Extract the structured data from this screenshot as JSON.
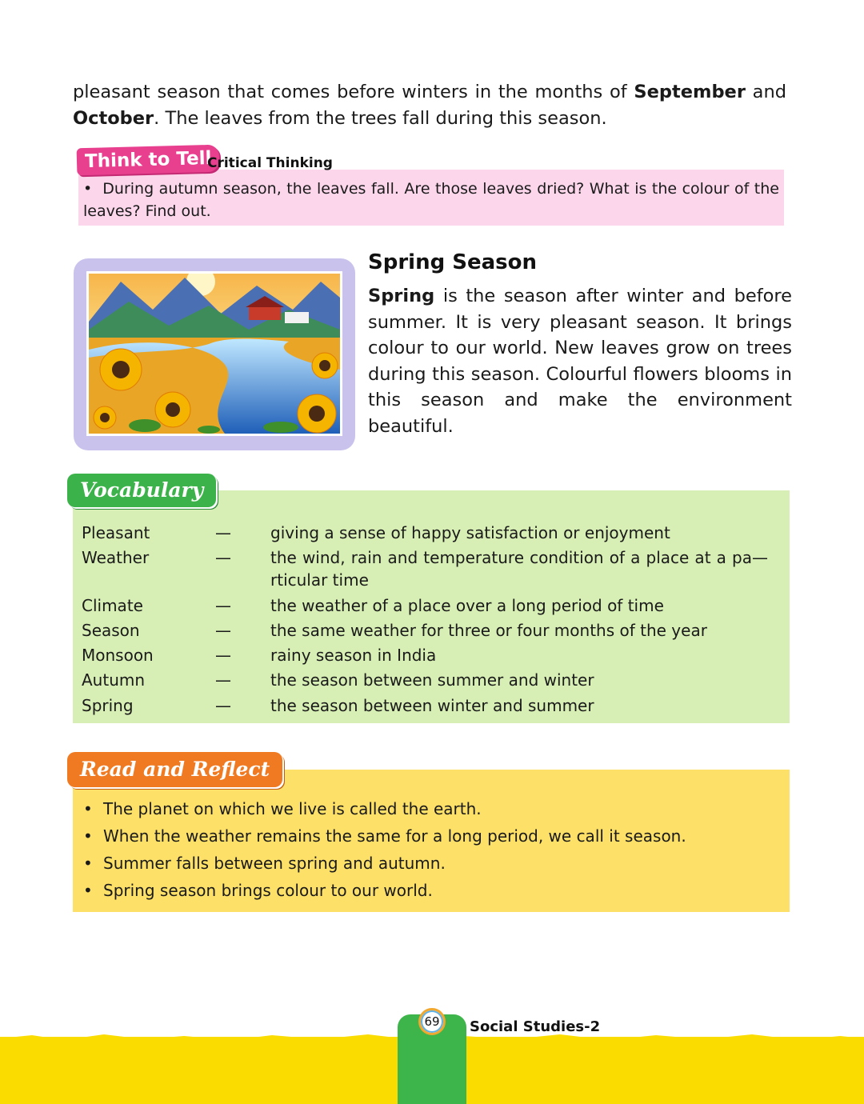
{
  "intro": {
    "part1": "pleasant season that comes before winters in the months of ",
    "bold1": "September",
    "part2": " and ",
    "bold2": "October",
    "part3": ". The leaves from the trees fall during this season."
  },
  "think_to_tell": {
    "tag": "Think to Tell",
    "subtitle": "Critical Thinking",
    "bullet": "•",
    "text": "During autumn season, the leaves fall. Are those leaves dried? What is the colour of the leaves? Find out."
  },
  "spring": {
    "title": "Spring Season",
    "bold": "Spring",
    "text": " is the season after winter and before summer. It is very pleasant season. It brings colour to our world. New leaves grow on trees during this season. Colourful flowers blooms in this season and make the environment beautiful."
  },
  "vocabulary": {
    "tag": "Vocabulary",
    "dash": "—",
    "items": [
      {
        "term": "Pleasant",
        "definition": "giving a sense of happy satisfaction or enjoyment"
      },
      {
        "term": "Weather",
        "definition": "the wind, rain and temperature condition of a place at a pa—rticular time"
      },
      {
        "term": "Climate",
        "definition": "the weather of a place over a long period of time"
      },
      {
        "term": "Season",
        "definition": "the same weather for three or four months of the year"
      },
      {
        "term": "Monsoon",
        "definition": "rainy season in India"
      },
      {
        "term": "Autumn",
        "definition": "the season between summer and winter"
      },
      {
        "term": "Spring",
        "definition": "the season between winter and summer"
      }
    ]
  },
  "read_and_reflect": {
    "tag": "Read and Reflect",
    "items": [
      "The planet on which we live is called the earth.",
      "When the weather remains the same for a long period, we call it season.",
      "Summer falls between spring and autumn.",
      "Spring season brings colour to our world."
    ]
  },
  "footer": {
    "page_number": "69",
    "book_title": "Social Studies-2"
  },
  "colors": {
    "think_tag": "#e8408f",
    "think_box": "#fcd6eb",
    "vocab_tag": "#3cb34a",
    "vocab_box": "#d7efb4",
    "reflect_tag": "#ef7a22",
    "reflect_box": "#fde068",
    "footer_band": "#fbdc00"
  }
}
